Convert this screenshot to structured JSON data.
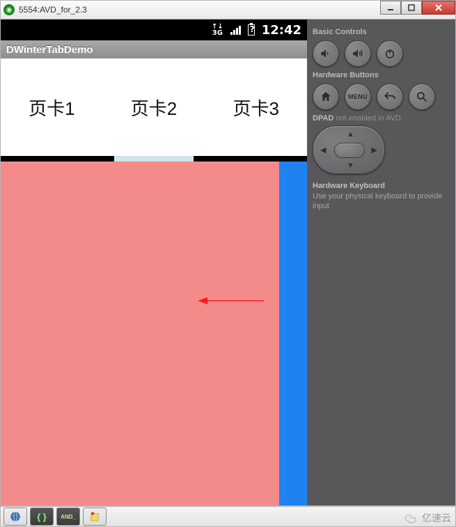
{
  "window": {
    "title": "5554:AVD_for_2.3"
  },
  "phone": {
    "status": {
      "network": "3G",
      "time": "12:42"
    },
    "app_title": "DWinterTabDemo",
    "tabs": [
      "页卡1",
      "页卡2",
      "页卡3"
    ],
    "active_tab_index": 1,
    "pages": {
      "left_color": "#f48b8b",
      "right_color": "#1e82f0"
    }
  },
  "side": {
    "basic_label": "Basic Controls",
    "hardware_label": "Hardware Buttons",
    "menu_label": "MENU",
    "dpad_label": "DPAD",
    "dpad_note": "not enabled in AVD",
    "kbd_label": "Hardware Keyboard",
    "kbd_note": "Use your physical keyboard to provide input"
  },
  "watermark": "亿速云",
  "icons": {
    "volume_down": "volume-down-icon",
    "volume_up": "volume-up-icon",
    "power": "power-icon",
    "home": "home-icon",
    "menu": "menu-icon",
    "back": "back-icon",
    "search": "search-icon"
  }
}
